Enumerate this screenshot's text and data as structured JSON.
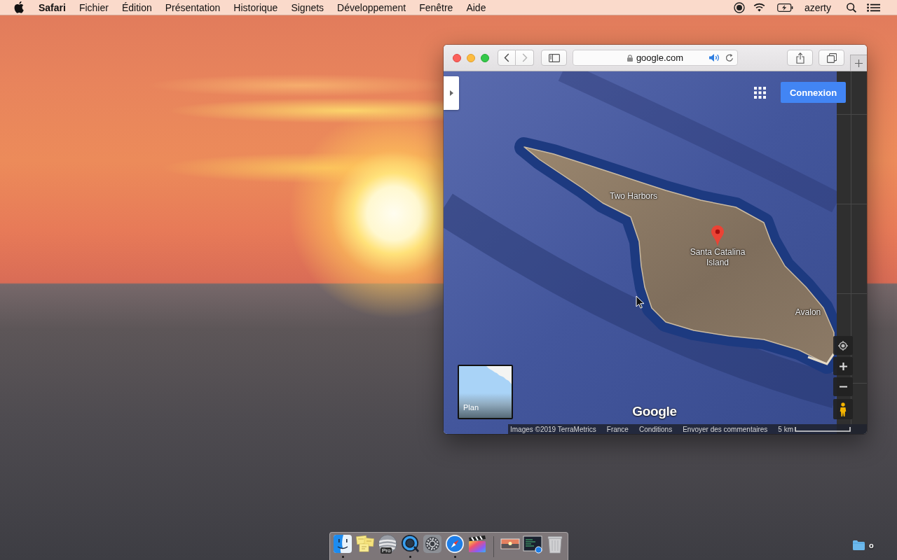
{
  "menu_bar": {
    "app_name": "Safari",
    "menus": [
      "Fichier",
      "Édition",
      "Présentation",
      "Historique",
      "Signets",
      "Développement",
      "Fenêtre",
      "Aide"
    ],
    "input_source": "azerty"
  },
  "browser": {
    "navigation": {
      "back_enabled": true,
      "forward_enabled": false
    },
    "address": "google.com",
    "secure": true,
    "audio_playing": true
  },
  "map": {
    "sign_in_button": "Connexion",
    "places": [
      {
        "name": "Two Harbors",
        "pinned": false
      },
      {
        "name": "Santa Catalina Island",
        "pinned": true
      },
      {
        "name": "Avalon",
        "pinned": false
      }
    ],
    "map_type_toggle": "Plan",
    "logo": "Google",
    "attribution": [
      "Images ©2019 TerraMetrics",
      "France",
      "Conditions",
      "Envoyer des commentaires"
    ],
    "scale": "5 km"
  },
  "dock": {
    "apps": [
      {
        "running": true
      },
      {
        "running": false
      },
      {
        "running": false,
        "badge": "Pro"
      },
      {
        "running": true
      },
      {
        "running": false
      },
      {
        "running": true
      },
      {
        "running": false
      }
    ]
  },
  "desktop": {
    "items": [
      {
        "label": "o"
      }
    ]
  }
}
